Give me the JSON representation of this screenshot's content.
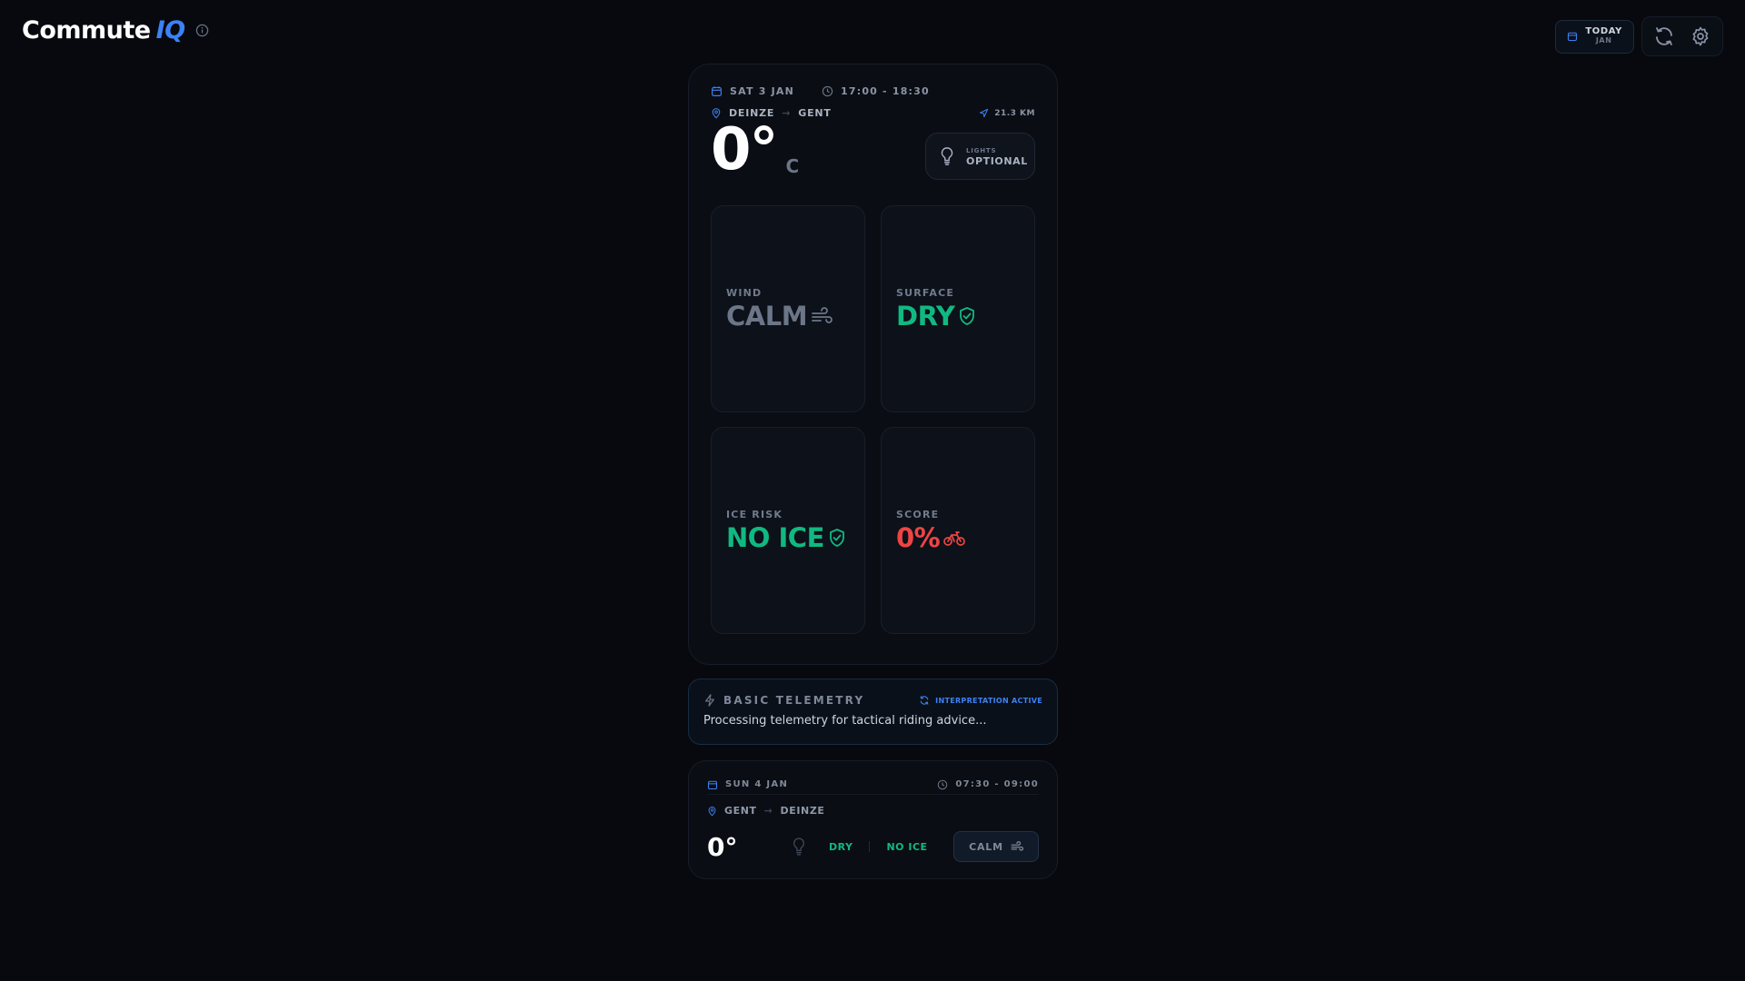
{
  "app": {
    "title": "Commute",
    "title_accent": "IQ"
  },
  "header": {
    "today_label": "TODAY",
    "today_month": "JAN",
    "refresh_icon": "refresh-icon",
    "settings_icon": "gear-icon"
  },
  "current": {
    "date": "SAT 3 JAN",
    "time": "17:00 - 18:30",
    "from": "DEINZE",
    "to": "GENT",
    "distance": "21.3 KM",
    "temperature": "0°",
    "unit": "C",
    "lights_label": "LIGHTS",
    "lights_value": "OPTIONAL",
    "tiles": [
      {
        "label": "WIND",
        "value": "CALM",
        "color": "#6b7688",
        "icon": "wind-icon"
      },
      {
        "label": "SURFACE",
        "value": "DRY",
        "color": "#10b981",
        "icon": "shield-check-icon"
      },
      {
        "label": "ICE RISK",
        "value": "NO ICE",
        "color": "#10b981",
        "icon": "shield-check-icon"
      },
      {
        "label": "SCORE",
        "value": "0%",
        "color": "#ef4444",
        "icon": "bike-icon"
      }
    ]
  },
  "telemetry": {
    "title": "BASIC TELEMETRY",
    "status": "INTERPRETATION ACTIVE",
    "message": "Processing telemetry for tactical riding advice..."
  },
  "next": {
    "date": "SUN 4 JAN",
    "time": "07:30 - 09:00",
    "from": "GENT",
    "to": "DEINZE",
    "temperature": "0°",
    "surface": "DRY",
    "ice": "NO ICE",
    "wind": "CALM"
  },
  "colors": {
    "accent": "#3b82f6",
    "good": "#10b981",
    "bad": "#ef4444",
    "muted": "#6b7688"
  }
}
